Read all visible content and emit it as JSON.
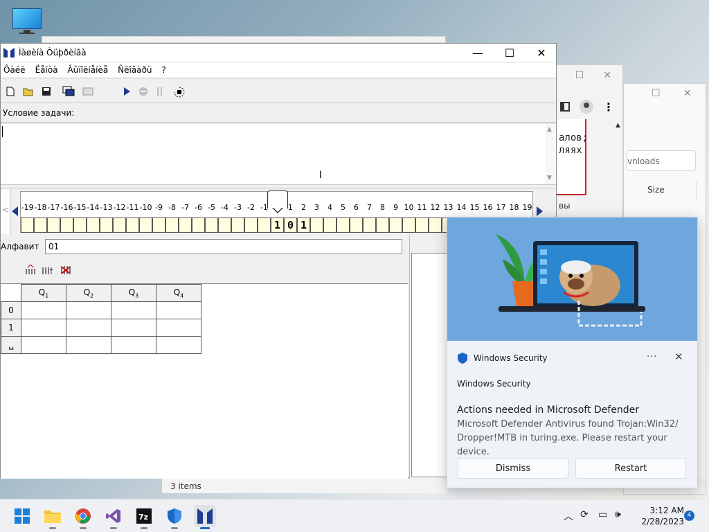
{
  "desktop": {
    "icon": "this-pc-icon"
  },
  "main_window": {
    "title": "Ìàøèíà Òüþðèíãà",
    "controls": {
      "minimize": "—",
      "maximize": "☐",
      "close": "✕"
    },
    "menu": [
      "Ôàéë",
      "Ëåíòà",
      "Âûïîëíåíèå",
      "Ñëîâàðü",
      "?"
    ],
    "condition_label": "Условие задачи:",
    "tape": {
      "ticks": [
        "-19",
        "-18",
        "-17",
        "-16",
        "-15",
        "-14",
        "-13",
        "-12",
        "-11",
        "-10",
        "-9",
        "-8",
        "-7",
        "-6",
        "-5",
        "-4",
        "-3",
        "-2",
        "-1",
        "0",
        "1",
        "2",
        "3",
        "4",
        "5",
        "6",
        "7",
        "8",
        "9",
        "10",
        "11",
        "12",
        "13",
        "14",
        "15",
        "16",
        "17",
        "18",
        "19"
      ],
      "cells": [
        "",
        "",
        "",
        "",
        "",
        "",
        "",
        "",
        "",
        "",
        "",
        "",
        "",
        "",
        "",
        "",
        "",
        "",
        "",
        "1",
        "0",
        "1",
        "",
        "",
        "",
        "",
        "",
        "",
        "",
        "",
        "",
        "",
        "",
        "",
        "",
        "",
        "",
        "",
        ""
      ],
      "head_position": "0"
    },
    "alphabet_label": "Алфавит",
    "alphabet_value": "01",
    "states_table": {
      "columns": [
        "Q",
        "Q",
        "Q",
        "Q"
      ],
      "column_subs": [
        "1",
        "2",
        "3",
        "4"
      ],
      "rows": [
        "0",
        "1",
        "␣"
      ]
    }
  },
  "background": {
    "browser_code": [
      "алов;",
      "ляях"
    ],
    "browser_tail": "вы",
    "downloads_placeholder": "vnloads",
    "size_header": "Size",
    "status": "3 items"
  },
  "notification": {
    "source": "Windows Security",
    "more": "···",
    "close": "✕",
    "app_name": "Windows Security",
    "title": "Actions needed in Microsoft Defender",
    "message": "Microsoft Defender Antivirus found Trojan:Win32/ Dropper!MTB in turing.exe. Please restart your device.",
    "dismiss": "Dismiss",
    "restart": "Restart"
  },
  "taskbar": {
    "time": "3:12 AM",
    "date": "2/28/2023",
    "notifications_count": "4",
    "apps": [
      "start-icon",
      "file-explorer-icon",
      "chrome-icon",
      "visual-studio-icon",
      "7zip-icon",
      "windows-security-icon",
      "turing-machine-icon"
    ]
  },
  "colors": {
    "accent": "#1a66c7",
    "tape_cell": "#ffffe0",
    "arrow": "#1f3b8f",
    "hero": "#6ea6de"
  }
}
